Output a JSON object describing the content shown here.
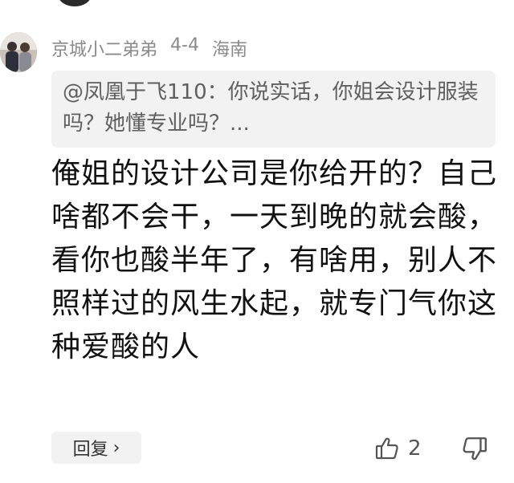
{
  "top_partial": {
    "text": "-- ----"
  },
  "comment": {
    "username": "京城小二弟弟",
    "date": "4-4",
    "location": "海南",
    "quote": "@凤凰于飞110：你说实话，你姐会设计服装吗？她懂专业吗？...",
    "body": "俺姐的设计公司是你给开的？自己啥都不会干，一天到晚的就会酸，看你也酸半年了，有啥用，别人不照样过的风生水起，就专门气你这种爱酸的人",
    "reply_label": "回复",
    "reply_chevron": "›",
    "like_count": "2"
  },
  "icons": {
    "avatar": "avatar-photo",
    "like": "thumbs-up-icon",
    "dislike": "thumbs-down-icon"
  }
}
